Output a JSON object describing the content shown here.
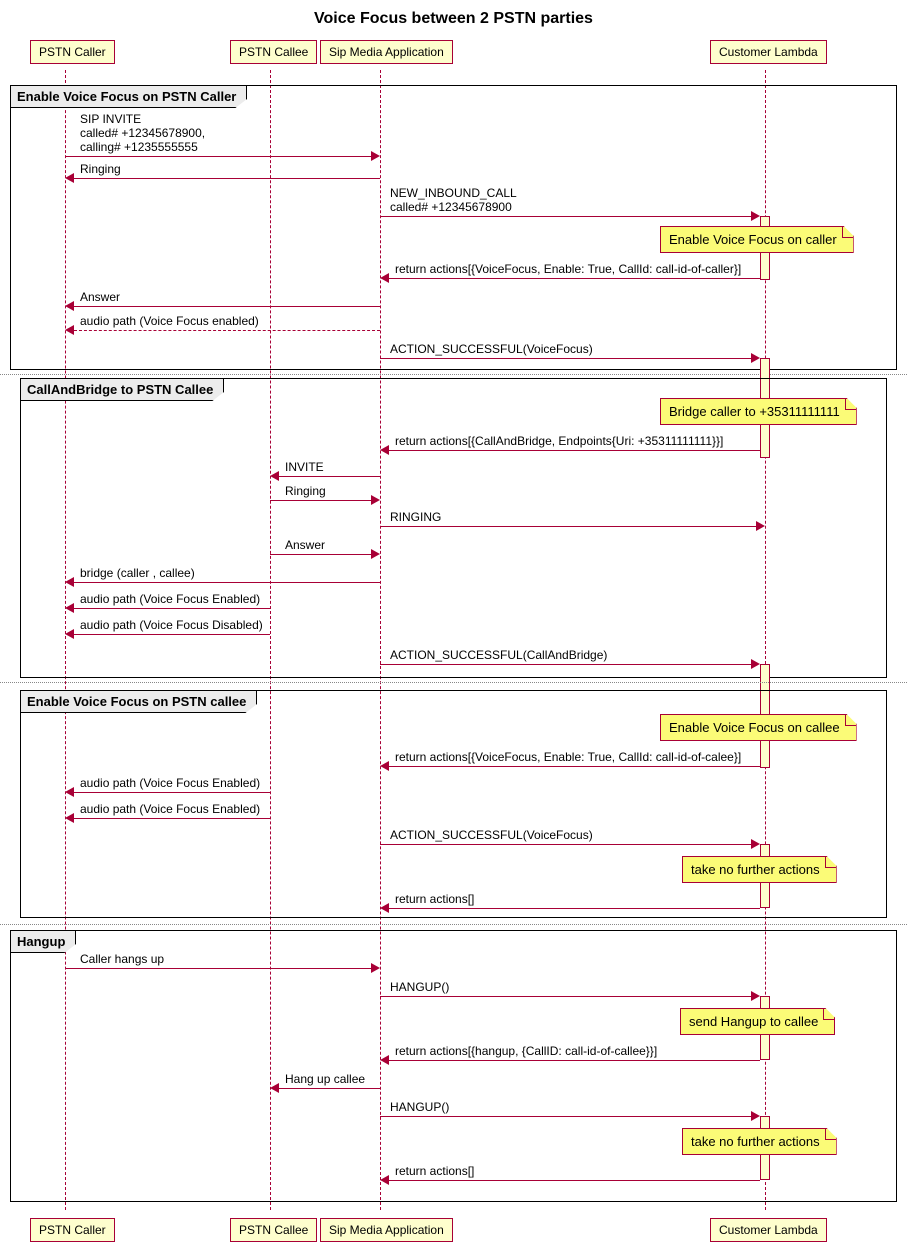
{
  "title": "Voice Focus between 2 PSTN parties",
  "participants": {
    "caller": "PSTN Caller",
    "callee": "PSTN Callee",
    "sma": "Sip Media Application",
    "lambda": "Customer Lambda"
  },
  "groups": {
    "g1": "Enable Voice Focus on PSTN Caller",
    "g2": "CallAndBridge to PSTN Callee",
    "g3": "Enable Voice Focus on PSTN callee",
    "g4": "Hangup"
  },
  "notes": {
    "n1": "Enable Voice Focus on caller",
    "n2": "Bridge caller to +35311111111",
    "n3": "Enable Voice Focus on callee",
    "n4": "take no further actions",
    "n5": "send Hangup to callee",
    "n6": "take no further actions"
  },
  "messages": {
    "m1a": "SIP INVITE",
    "m1b": "called# +12345678900,",
    "m1c": "calling# +1235555555",
    "m2": "Ringing",
    "m3a": "NEW_INBOUND_CALL",
    "m3b": "called# +12345678900",
    "m4": "return actions[{VoiceFocus, Enable: True, CallId: call-id-of-caller}]",
    "m5": "Answer",
    "m6": "audio path (Voice Focus enabled)",
    "m7": "ACTION_SUCCESSFUL(VoiceFocus)",
    "m8": "return actions[{CallAndBridge, Endpoints{Uri: +35311111111}}]",
    "m9": "INVITE",
    "m10": "Ringing",
    "m11": "RINGING",
    "m12": "Answer",
    "m13": "bridge (caller , callee)",
    "m14": "audio path (Voice Focus Enabled)",
    "m15": "audio path (Voice Focus Disabled)",
    "m16": "ACTION_SUCCESSFUL(CallAndBridge)",
    "m17": "return actions[{VoiceFocus, Enable: True, CallId: call-id-of-calee}]",
    "m18": "audio path (Voice Focus Enabled)",
    "m19": "audio path (Voice Focus Enabled)",
    "m20": "ACTION_SUCCESSFUL(VoiceFocus)",
    "m21": "return actions[]",
    "m22": "Caller hangs up",
    "m23": "HANGUP()",
    "m24": "return actions[{hangup, {CallID: call-id-of-callee}}]",
    "m25": "Hang up callee",
    "m26": "HANGUP()",
    "m27": "return actions[]"
  },
  "chart_data": {
    "type": "sequence",
    "title": "Voice Focus between 2 PSTN parties",
    "participants": [
      "PSTN Caller",
      "PSTN Callee",
      "Sip Media Application",
      "Customer Lambda"
    ],
    "groups": [
      {
        "label": "Enable Voice Focus on PSTN Caller",
        "messages": [
          {
            "from": "PSTN Caller",
            "to": "Sip Media Application",
            "text": "SIP INVITE called# +12345678900, calling# +1235555555"
          },
          {
            "from": "Sip Media Application",
            "to": "PSTN Caller",
            "text": "Ringing"
          },
          {
            "from": "Sip Media Application",
            "to": "Customer Lambda",
            "text": "NEW_INBOUND_CALL called# +12345678900"
          },
          {
            "note_over": "Customer Lambda",
            "text": "Enable Voice Focus on caller"
          },
          {
            "from": "Customer Lambda",
            "to": "Sip Media Application",
            "text": "return actions[{VoiceFocus, Enable: True, CallId: call-id-of-caller}]"
          },
          {
            "from": "Sip Media Application",
            "to": "PSTN Caller",
            "text": "Answer"
          },
          {
            "from": "Sip Media Application",
            "to": "PSTN Caller",
            "style": "dashed",
            "text": "audio path (Voice Focus enabled)"
          },
          {
            "from": "Sip Media Application",
            "to": "Customer Lambda",
            "text": "ACTION_SUCCESSFUL(VoiceFocus)"
          }
        ]
      },
      {
        "label": "CallAndBridge to PSTN Callee",
        "messages": [
          {
            "note_over": "Customer Lambda",
            "text": "Bridge caller to +35311111111"
          },
          {
            "from": "Customer Lambda",
            "to": "Sip Media Application",
            "text": "return actions[{CallAndBridge, Endpoints{Uri: +35311111111}}]"
          },
          {
            "from": "Sip Media Application",
            "to": "PSTN Callee",
            "text": "INVITE"
          },
          {
            "from": "PSTN Callee",
            "to": "Sip Media Application",
            "text": "Ringing"
          },
          {
            "from": "Sip Media Application",
            "to": "Customer Lambda",
            "text": "RINGING"
          },
          {
            "from": "PSTN Callee",
            "to": "Sip Media Application",
            "text": "Answer"
          },
          {
            "from": "Sip Media Application",
            "to": "PSTN Caller",
            "text": "bridge (caller , callee)"
          },
          {
            "from": "PSTN Callee",
            "to": "PSTN Caller",
            "text": "audio path (Voice Focus Enabled)"
          },
          {
            "from": "PSTN Callee",
            "to": "PSTN Caller",
            "text": "audio path (Voice Focus Disabled)"
          },
          {
            "from": "Sip Media Application",
            "to": "Customer Lambda",
            "text": "ACTION_SUCCESSFUL(CallAndBridge)"
          }
        ]
      },
      {
        "label": "Enable Voice Focus on PSTN callee",
        "messages": [
          {
            "note_over": "Customer Lambda",
            "text": "Enable Voice Focus on callee"
          },
          {
            "from": "Customer Lambda",
            "to": "Sip Media Application",
            "text": "return actions[{VoiceFocus, Enable: True, CallId: call-id-of-calee}]"
          },
          {
            "from": "PSTN Callee",
            "to": "PSTN Caller",
            "text": "audio path (Voice Focus Enabled)"
          },
          {
            "from": "PSTN Callee",
            "to": "PSTN Caller",
            "text": "audio path (Voice Focus Enabled)"
          },
          {
            "from": "Sip Media Application",
            "to": "Customer Lambda",
            "text": "ACTION_SUCCESSFUL(VoiceFocus)"
          },
          {
            "note_over": "Customer Lambda",
            "text": "take no further actions"
          },
          {
            "from": "Customer Lambda",
            "to": "Sip Media Application",
            "text": "return actions[]"
          }
        ]
      },
      {
        "label": "Hangup",
        "messages": [
          {
            "from": "PSTN Caller",
            "to": "Sip Media Application",
            "text": "Caller hangs up"
          },
          {
            "from": "Sip Media Application",
            "to": "Customer Lambda",
            "text": "HANGUP()"
          },
          {
            "note_over": "Customer Lambda",
            "text": "send Hangup to callee"
          },
          {
            "from": "Customer Lambda",
            "to": "Sip Media Application",
            "text": "return actions[{hangup, {CallID: call-id-of-callee}}]"
          },
          {
            "from": "Sip Media Application",
            "to": "PSTN Callee",
            "text": "Hang up callee"
          },
          {
            "from": "Sip Media Application",
            "to": "Customer Lambda",
            "text": "HANGUP()"
          },
          {
            "note_over": "Customer Lambda",
            "text": "take no further actions"
          },
          {
            "from": "Customer Lambda",
            "to": "Sip Media Application",
            "text": "return actions[]"
          }
        ]
      }
    ]
  }
}
